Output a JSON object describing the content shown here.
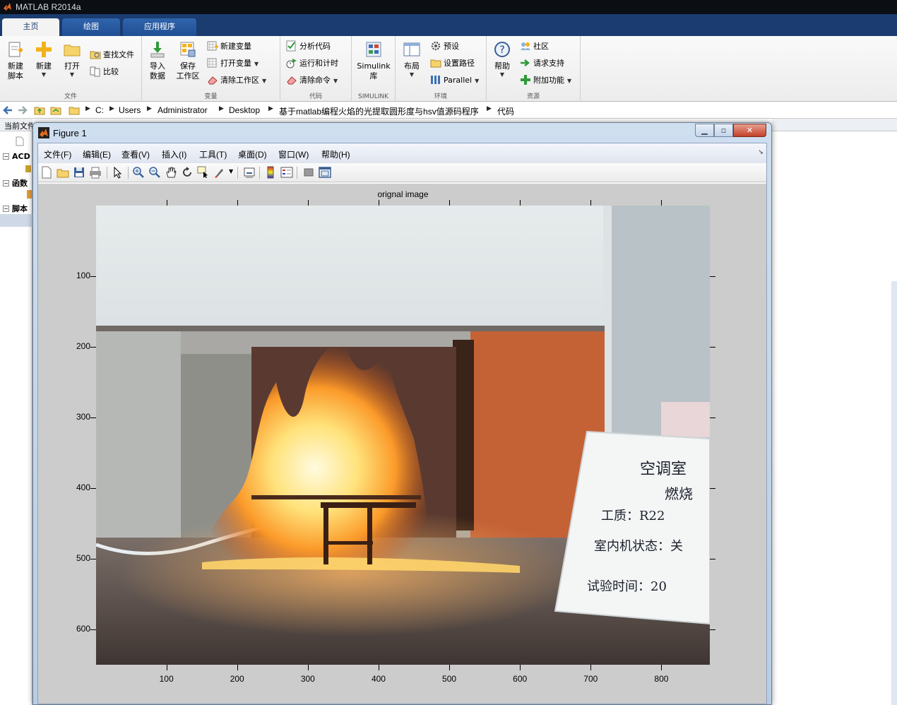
{
  "app": {
    "title": "MATLAB R2014a"
  },
  "main_tabs": [
    {
      "label": "主页"
    },
    {
      "label": "绘图"
    },
    {
      "label": "应用程序"
    }
  ],
  "ribbon": {
    "file_group": {
      "label": "文件",
      "new_script": [
        "新建",
        "脚本"
      ],
      "new": "新建",
      "open": "打开",
      "find_files": "查找文件",
      "compare": "比较"
    },
    "variable_group": {
      "label": "变量",
      "import": [
        "导入",
        "数据"
      ],
      "save": [
        "保存",
        "工作区"
      ],
      "new_variable": "新建变量",
      "open_variable": "打开变量",
      "clear_workspace": "清除工作区"
    },
    "code_group": {
      "label": "代码",
      "analyze": "分析代码",
      "run_time": "运行和计时",
      "clear_commands": "清除命令"
    },
    "simulink_group": {
      "label": "SIMULINK",
      "simulink": [
        "Simulink",
        "库"
      ]
    },
    "env_group": {
      "label": "环境",
      "layout": "布局",
      "preferences": "预设",
      "set_path": "设置路径",
      "parallel": "Parallel"
    },
    "resources_group": {
      "label": "资源",
      "help": "帮助",
      "community": "社区",
      "request_support": "请求支持",
      "addons": "附加功能"
    }
  },
  "address_bar": {
    "path": [
      "C:",
      "Users",
      "Administrator",
      "Desktop",
      "基于matlab编程火焰的光提取圆形度与hsv值源码程序",
      "代码"
    ]
  },
  "left_panel": {
    "header": "当前文件夹",
    "items": [
      "ACD",
      "函数",
      "脚本"
    ]
  },
  "figure": {
    "title": "Figure 1",
    "menu": [
      "文件(F)",
      "编辑(E)",
      "查看(V)",
      "插入(I)",
      "工具(T)",
      "桌面(D)",
      "窗口(W)",
      "帮助(H)"
    ],
    "toolbar_icons": [
      "new-figure-icon",
      "open-icon",
      "save-icon",
      "print-icon",
      "pointer-icon",
      "zoom-in-icon",
      "zoom-out-icon",
      "pan-icon",
      "rotate-icon",
      "data-cursor-icon",
      "brush-icon",
      "link-plot-icon",
      "colorbar-icon",
      "legend-icon",
      "hide-plot-tools-icon",
      "show-plot-tools-icon"
    ],
    "axes": {
      "title": "orignal image",
      "x_ticks": [
        "100",
        "200",
        "300",
        "400",
        "500",
        "600",
        "700",
        "800"
      ],
      "y_ticks": [
        "100",
        "200",
        "300",
        "400",
        "500",
        "600"
      ],
      "x_tick_values": [
        100,
        200,
        300,
        400,
        500,
        600,
        700,
        800
      ],
      "y_tick_values": [
        100,
        200,
        300,
        400,
        500,
        600
      ],
      "x_range": [
        0.5,
        868.5
      ],
      "y_range": [
        0.5,
        650.5
      ]
    },
    "image_whiteboard_text": [
      "空调室",
      "燃烧",
      "工质：R22",
      "室内机状态：关",
      "试验时间：20"
    ]
  },
  "colors": {
    "titlebar": "#0b0e12",
    "tabstrip": "#1a3c70",
    "figure_bg": "#cccccc",
    "flame_core": "#fff2a8",
    "flame_outer": "#f26a10"
  }
}
